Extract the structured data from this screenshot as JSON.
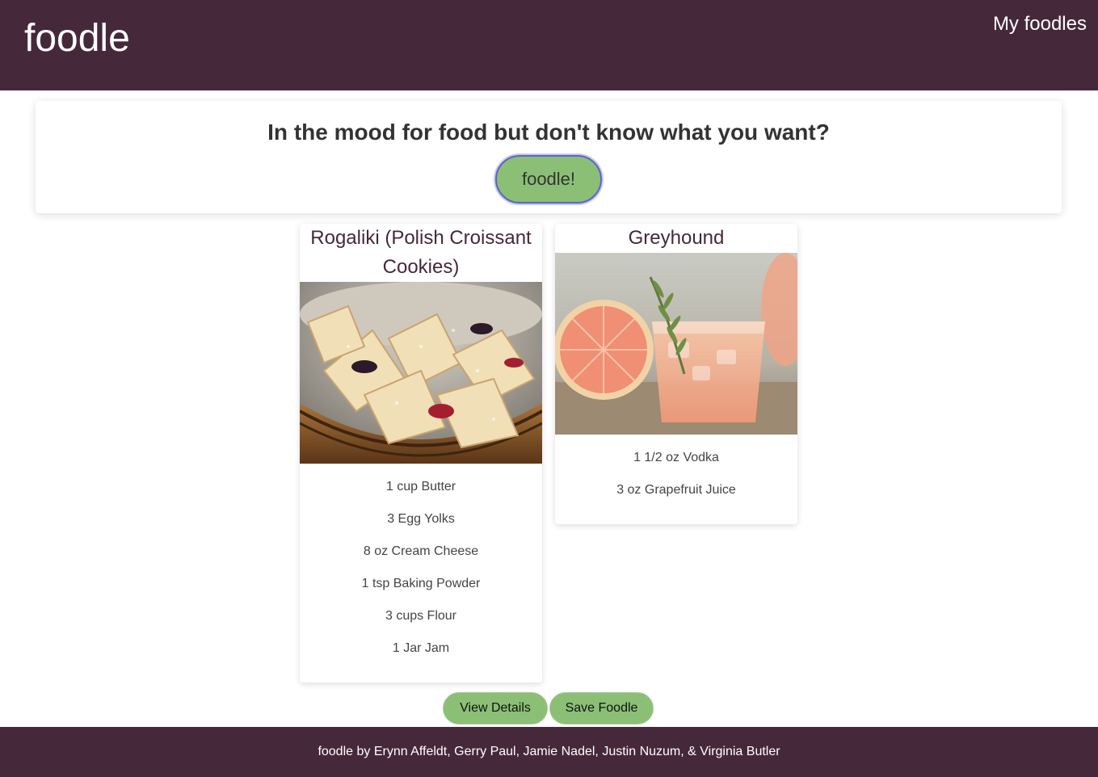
{
  "header": {
    "brand": "foodle",
    "nav_link": "My foodles",
    "bg_color": "#45293a"
  },
  "hero": {
    "heading": "In the mood for food but don't know what you want?",
    "button_label": "foodle!"
  },
  "recipes": [
    {
      "title": "Rogaliki (Polish Croissant Cookies)",
      "image_icon": "pastry-photo",
      "ingredients": [
        "1 cup Butter",
        "3 Egg Yolks",
        "8 oz Cream Cheese",
        "1 tsp Baking Powder",
        "3 cups Flour",
        "1 Jar Jam"
      ]
    },
    {
      "title": "Greyhound",
      "image_icon": "cocktail-photo",
      "ingredients": [
        "1 1/2 oz Vodka",
        "3 oz Grapefruit Juice"
      ]
    }
  ],
  "actions": {
    "view_details": "View Details",
    "save_foodle": "Save Foodle",
    "accent_color": "#8bbf75"
  },
  "footer": {
    "credits": "foodle by Erynn Affeldt, Gerry Paul, Jamie Nadel, Justin Nuzum, & Virginia Butler"
  }
}
